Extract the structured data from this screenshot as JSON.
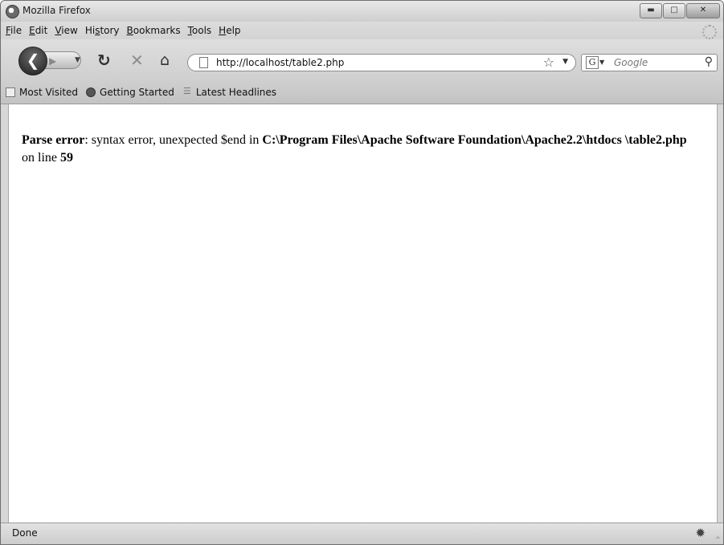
{
  "window": {
    "title": "Mozilla Firefox"
  },
  "menubar": {
    "items": [
      {
        "label": "File",
        "accel": "F",
        "rest": "ile"
      },
      {
        "label": "Edit",
        "accel": "E",
        "rest": "dit"
      },
      {
        "label": "View",
        "accel": "V",
        "rest": "iew"
      },
      {
        "label": "History",
        "pre": "Hi",
        "accel": "s",
        "rest": "tory"
      },
      {
        "label": "Bookmarks",
        "accel": "B",
        "rest": "ookmarks"
      },
      {
        "label": "Tools",
        "accel": "T",
        "rest": "ools"
      },
      {
        "label": "Help",
        "accel": "H",
        "rest": "elp"
      }
    ]
  },
  "navbar": {
    "url": "http://localhost/table2.php",
    "search_placeholder": "Google"
  },
  "bookmarks": {
    "items": [
      "Most Visited",
      "Getting Started",
      "Latest Headlines"
    ]
  },
  "content": {
    "error_label": "Parse error",
    "error_message": ": syntax error, unexpected $end in ",
    "error_path": "C:\\Program Files\\Apache Software Foundation\\Apache2.2\\htdocs \\table2.php",
    "error_line_prefix": " on line ",
    "error_line": "59"
  },
  "statusbar": {
    "text": "Done"
  }
}
